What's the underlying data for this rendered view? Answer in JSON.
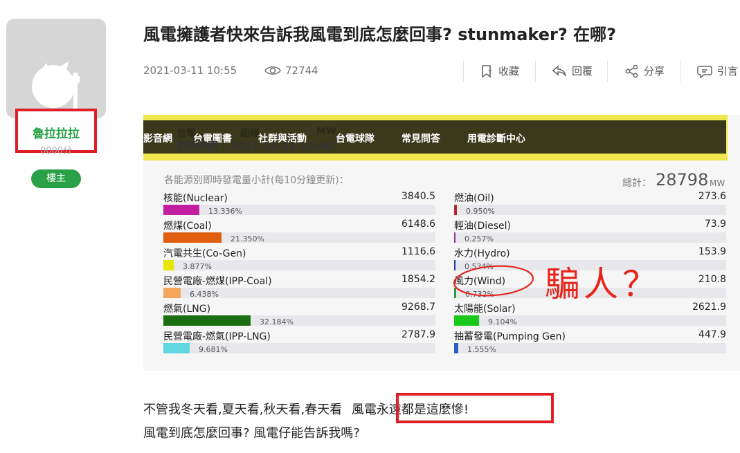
{
  "author": {
    "name": "魯拉拉拉",
    "sub": "0000分",
    "badge": "樓主"
  },
  "post": {
    "title": "風電擁護者快來告訴我風電到底怎麼回事? stunmaker? 在哪?",
    "date": "2021-03-11 10:55",
    "views": "72744",
    "actions": {
      "bookmark": "收藏",
      "reply": "回覆",
      "share": "分享",
      "quote": "引言"
    }
  },
  "screenshot": {
    "nav": [
      "影音網",
      "台電圖書",
      "社群與活動",
      "台電球隊",
      "常見問答",
      "用電診斷中心"
    ],
    "ghost_text": [
      "台電",
      "組綠",
      "MW"
    ],
    "update_time": "更新時間 - 2021-03-11 10:40",
    "subheading": "各能源別即時發電量小計(每10分鐘更新)：",
    "total_label": "總計：",
    "total_value": "28798",
    "total_unit": "MW",
    "handwriting": "騙人？",
    "sources_left": [
      {
        "name": "核能(Nuclear)",
        "value": "3840.5",
        "percent": "13.336%",
        "fraction": 0.13336,
        "color": "#c31ea0"
      },
      {
        "name": "燃煤(Coal)",
        "value": "6148.6",
        "percent": "21.350%",
        "fraction": 0.2135,
        "color": "#e0600f"
      },
      {
        "name": "汽電共生(Co-Gen)",
        "value": "1116.6",
        "percent": "3.877%",
        "fraction": 0.03877,
        "color": "#e6e600"
      },
      {
        "name": "民營電廠-燃煤(IPP-Coal)",
        "value": "1854.2",
        "percent": "6.438%",
        "fraction": 0.06438,
        "color": "#f4a55a"
      },
      {
        "name": "燃氣(LNG)",
        "value": "9268.7",
        "percent": "32.184%",
        "fraction": 0.32184,
        "color": "#1b6e12"
      },
      {
        "name": "民營電廠-燃氣(IPP-LNG)",
        "value": "2787.9",
        "percent": "9.681%",
        "fraction": 0.09681,
        "color": "#5fd6e0"
      }
    ],
    "sources_right": [
      {
        "name": "燃油(Oil)",
        "value": "273.6",
        "percent": "0.950%",
        "fraction": 0.0095,
        "color": "#b3262a"
      },
      {
        "name": "輕油(Diesel)",
        "value": "73.9",
        "percent": "0.257%",
        "fraction": 0.00257,
        "color": "#8a3a8a"
      },
      {
        "name": "水力(Hydro)",
        "value": "153.9",
        "percent": "0.534%",
        "fraction": 0.00534,
        "color": "#1f3aa8"
      },
      {
        "name": "風力(Wind)",
        "value": "210.8",
        "percent": "0.732%",
        "fraction": 0.00732,
        "color": "#2a9c3c"
      },
      {
        "name": "太陽能(Solar)",
        "value": "2621.9",
        "percent": "9.104%",
        "fraction": 0.09104,
        "color": "#19c919"
      },
      {
        "name": "抽蓄發電(Pumping Gen)",
        "value": "447.9",
        "percent": "1.555%",
        "fraction": 0.01555,
        "color": "#2d5ec4"
      }
    ]
  },
  "body": {
    "line1_prefix": "不管我冬天看,夏天看,秋天看,春天看",
    "line1_highlight": "風電永遠都是這麼慘!",
    "line2": "風電到底怎麼回事? 風電仔能告訴我嗎?"
  },
  "colors": {
    "accent_green": "#2aa148",
    "highlight_red": "#e01e26",
    "banner_yellow": "#f0e64e"
  }
}
